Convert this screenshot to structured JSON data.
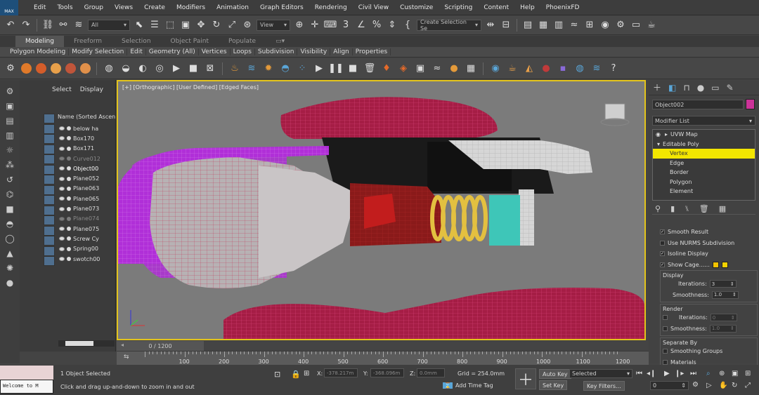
{
  "app": {
    "logo_text": "MAX"
  },
  "menu": [
    "Edit",
    "Tools",
    "Group",
    "Views",
    "Create",
    "Modifiers",
    "Animation",
    "Graph Editors",
    "Rendering",
    "Civil View",
    "Customize",
    "Scripting",
    "Content",
    "Help",
    "PhoenixFD"
  ],
  "toolbar": {
    "selection_filter": "All",
    "ref_coord": "View",
    "named_selection": "Create Selection Se"
  },
  "ribbon": {
    "tabs": [
      "Modeling",
      "Freeform",
      "Selection",
      "Object Paint",
      "Populate"
    ],
    "active_tab": "Modeling",
    "sub_items": [
      "Polygon Modeling",
      "Modify Selection",
      "Edit",
      "Geometry (All)",
      "Vertices",
      "Loops",
      "Subdivision",
      "Visibility",
      "Align",
      "Properties"
    ]
  },
  "scene_explorer": {
    "tabs": [
      "Select",
      "Display"
    ],
    "header": "Name (Sorted Ascen",
    "items": [
      {
        "name": "below ha",
        "state": "normal"
      },
      {
        "name": "Box170",
        "state": "normal"
      },
      {
        "name": "Box171",
        "state": "normal"
      },
      {
        "name": "Curve012",
        "state": "dim"
      },
      {
        "name": "Object00",
        "state": "selected"
      },
      {
        "name": "Plane052",
        "state": "normal"
      },
      {
        "name": "Plane063",
        "state": "normal"
      },
      {
        "name": "Plane065",
        "state": "normal"
      },
      {
        "name": "Plane073",
        "state": "normal"
      },
      {
        "name": "Plane074",
        "state": "dim"
      },
      {
        "name": "Plane075",
        "state": "normal"
      },
      {
        "name": "Screw Cy",
        "state": "normal"
      },
      {
        "name": "Spring00",
        "state": "normal"
      },
      {
        "name": "swotch00",
        "state": "normal"
      }
    ]
  },
  "viewport": {
    "label": "[+] [Orthographic] [User Defined] [Edged Faces]",
    "border_color": "#e3c41c"
  },
  "command_panel": {
    "object_name": "Object002",
    "object_color": "#cc3399",
    "modifier_list": "Modifier List",
    "stack": {
      "uvw": "UVW Map",
      "editable_poly": "Editable Poly",
      "sub_items": [
        "Vertex",
        "Edge",
        "Border",
        "Polygon",
        "Element"
      ],
      "active_sub": "Vertex"
    },
    "rollout": {
      "smooth_result": "Smooth Result",
      "use_nurms": "Use NURMS Subdivision",
      "isoline": "Isoline Display",
      "show_cage": "Show Cage......",
      "display_title": "Display",
      "iterations_label": "Iterations:",
      "display_iterations": "3",
      "smoothness_label": "Smoothness:",
      "display_smoothness": "1.0",
      "render_title": "Render",
      "render_iterations": "0",
      "render_smoothness": "1.0",
      "separate_title": "Separate By",
      "smoothing_groups": "Smoothing Groups",
      "materials": "Materials"
    }
  },
  "timeline": {
    "slider": "0 / 1200",
    "ticks": [
      "100",
      "200",
      "300",
      "400",
      "500",
      "600",
      "700",
      "800",
      "900",
      "1000",
      "1100",
      "1200"
    ]
  },
  "status": {
    "maxscript_text": "Welcome to M",
    "selected": "1 Object Selected",
    "prompt": "Click and drag up-and-down to zoom in and out",
    "x_label": "X:",
    "x_value": "-378.217m",
    "y_label": "Y:",
    "y_value": "-368.096m",
    "z_label": "Z:",
    "z_value": "0.0mm",
    "grid": "Grid = 254.0mm",
    "add_time_tag": "Add Time Tag",
    "auto_key": "Auto Key",
    "set_key": "Set Key",
    "selected_dropdown": "Selected",
    "key_filters": "Key Filters...",
    "frame": "0"
  }
}
